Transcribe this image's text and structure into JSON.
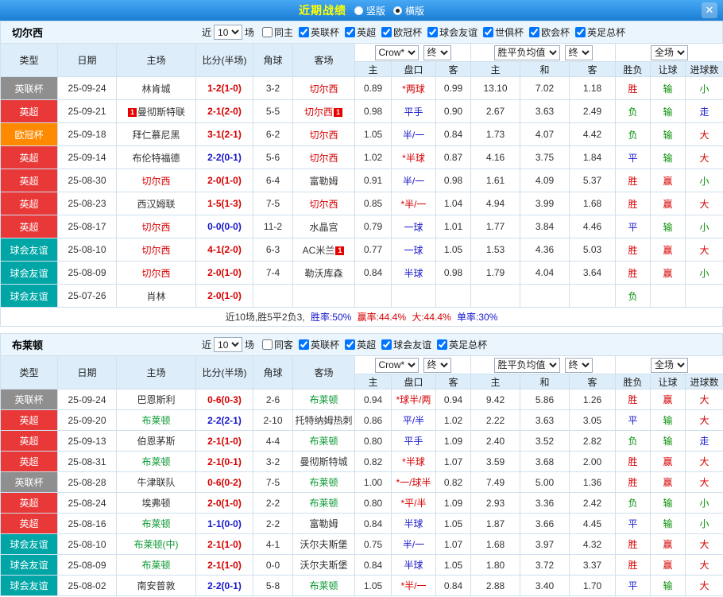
{
  "topbar": {
    "title": "近期战绩",
    "radio_vertical": "竖版",
    "radio_horizontal": "横版",
    "selected": "横版",
    "close": "✕"
  },
  "columns": {
    "type": "类型",
    "date": "日期",
    "home": "主场",
    "score": "比分(半场)",
    "corner": "角球",
    "away": "客场",
    "odds_home": "主",
    "odds_handicap": "盘口",
    "odds_away": "客",
    "avg_home": "主",
    "avg_draw": "和",
    "avg_away": "客",
    "result": "胜负",
    "handicap_result": "让球",
    "goals": "进球数"
  },
  "palette": {
    "type_colors": {
      "英联杯": "#8f8f8f",
      "英超": "#e83838",
      "欧冠杯": "#ff8a00",
      "球会友谊": "#00a6a6"
    },
    "result_colors": {
      "胜": "#d60000",
      "平": "#1515cc",
      "负": "#0b8f0b",
      "赢": "#d60000",
      "输": "#0b8f0b",
      "走": "#1515cc",
      "大": "#d60000",
      "小": "#0b8f0b"
    },
    "handicap_star_color": "#d60000",
    "handicap_color": "#1515cc",
    "score_win_color": "#d60000",
    "score_draw_color": "#1515cc"
  },
  "sections": [
    {
      "team": "切尔西",
      "team_color": "#d60000",
      "filter": {
        "near_label": "近",
        "count": "10",
        "matches_label": "场",
        "checkboxes": [
          {
            "label": "同主",
            "checked": false
          },
          {
            "label": "英联杯",
            "checked": true
          },
          {
            "label": "英超",
            "checked": true
          },
          {
            "label": "欧冠杯",
            "checked": true
          },
          {
            "label": "球会友谊",
            "checked": true
          },
          {
            "label": "世俱杯",
            "checked": true
          },
          {
            "label": "欧会杯",
            "checked": true
          },
          {
            "label": "英足总杯",
            "checked": true
          }
        ]
      },
      "selects": {
        "odds_source": "Crow*",
        "odds_time": "终",
        "avg_source": "胜平负均值",
        "avg_time": "终",
        "scope": "全场"
      },
      "rows": [
        {
          "type": "英联杯",
          "date": "25-09-24",
          "home": "林肯城",
          "home_card": "",
          "home_focus": false,
          "score": "1-2(1-0)",
          "corner": "3-2",
          "away": "切尔西",
          "away_card": "",
          "away_focus": true,
          "odds_home": "0.89",
          "handicap": "*两球",
          "odds_away": "0.99",
          "avg_home": "13.10",
          "avg_draw": "7.02",
          "avg_away": "1.18",
          "result": "胜",
          "handicap_result": "输",
          "goals": "小"
        },
        {
          "type": "英超",
          "date": "25-09-21",
          "home": "曼彻斯特联",
          "home_card": "1",
          "home_focus": false,
          "score": "2-1(2-0)",
          "corner": "5-5",
          "away": "切尔西",
          "away_card": "1",
          "away_focus": true,
          "odds_home": "0.98",
          "handicap": "平手",
          "odds_away": "0.90",
          "avg_home": "2.67",
          "avg_draw": "3.63",
          "avg_away": "2.49",
          "result": "负",
          "handicap_result": "输",
          "goals": "走"
        },
        {
          "type": "欧冠杯",
          "date": "25-09-18",
          "home": "拜仁慕尼黑",
          "home_card": "",
          "home_focus": false,
          "score": "3-1(2-1)",
          "corner": "6-2",
          "away": "切尔西",
          "away_card": "",
          "away_focus": true,
          "odds_home": "1.05",
          "handicap": "半/一",
          "odds_away": "0.84",
          "avg_home": "1.73",
          "avg_draw": "4.07",
          "avg_away": "4.42",
          "result": "负",
          "handicap_result": "输",
          "goals": "大"
        },
        {
          "type": "英超",
          "date": "25-09-14",
          "home": "布伦特福德",
          "home_card": "",
          "home_focus": false,
          "score": "2-2(0-1)",
          "corner": "5-6",
          "away": "切尔西",
          "away_card": "",
          "away_focus": true,
          "odds_home": "1.02",
          "handicap": "*半球",
          "odds_away": "0.87",
          "avg_home": "4.16",
          "avg_draw": "3.75",
          "avg_away": "1.84",
          "result": "平",
          "handicap_result": "输",
          "goals": "大"
        },
        {
          "type": "英超",
          "date": "25-08-30",
          "home": "切尔西",
          "home_card": "",
          "home_focus": true,
          "score": "2-0(1-0)",
          "corner": "6-4",
          "away": "富勒姆",
          "away_card": "",
          "away_focus": false,
          "odds_home": "0.91",
          "handicap": "半/一",
          "odds_away": "0.98",
          "avg_home": "1.61",
          "avg_draw": "4.09",
          "avg_away": "5.37",
          "result": "胜",
          "handicap_result": "赢",
          "goals": "小"
        },
        {
          "type": "英超",
          "date": "25-08-23",
          "home": "西汉姆联",
          "home_card": "",
          "home_focus": false,
          "score": "1-5(1-3)",
          "corner": "7-5",
          "away": "切尔西",
          "away_card": "",
          "away_focus": true,
          "odds_home": "0.85",
          "handicap": "*半/一",
          "odds_away": "1.04",
          "avg_home": "4.94",
          "avg_draw": "3.99",
          "avg_away": "1.68",
          "result": "胜",
          "handicap_result": "赢",
          "goals": "大"
        },
        {
          "type": "英超",
          "date": "25-08-17",
          "home": "切尔西",
          "home_card": "",
          "home_focus": true,
          "score": "0-0(0-0)",
          "corner": "11-2",
          "away": "水晶宫",
          "away_card": "",
          "away_focus": false,
          "odds_home": "0.79",
          "handicap": "一球",
          "odds_away": "1.01",
          "avg_home": "1.77",
          "avg_draw": "3.84",
          "avg_away": "4.46",
          "result": "平",
          "handicap_result": "输",
          "goals": "小"
        },
        {
          "type": "球会友谊",
          "date": "25-08-10",
          "home": "切尔西",
          "home_card": "",
          "home_focus": true,
          "score": "4-1(2-0)",
          "corner": "6-3",
          "away": "AC米兰",
          "away_card": "1",
          "away_focus": false,
          "odds_home": "0.77",
          "handicap": "一球",
          "odds_away": "1.05",
          "avg_home": "1.53",
          "avg_draw": "4.36",
          "avg_away": "5.03",
          "result": "胜",
          "handicap_result": "赢",
          "goals": "大"
        },
        {
          "type": "球会友谊",
          "date": "25-08-09",
          "home": "切尔西",
          "home_card": "",
          "home_focus": true,
          "score": "2-0(1-0)",
          "corner": "7-4",
          "away": "勒沃库森",
          "away_card": "",
          "away_focus": false,
          "odds_home": "0.84",
          "handicap": "半球",
          "odds_away": "0.98",
          "avg_home": "1.79",
          "avg_draw": "4.04",
          "avg_away": "3.64",
          "result": "胜",
          "handicap_result": "赢",
          "goals": "小"
        },
        {
          "type": "球会友谊",
          "date": "25-07-26",
          "home": "肖林",
          "home_card": "",
          "home_focus": false,
          "score": "2-0(1-0)",
          "corner": "",
          "away": "",
          "away_card": "",
          "away_focus": false,
          "odds_home": "",
          "handicap": "",
          "odds_away": "",
          "avg_home": "",
          "avg_draw": "",
          "avg_away": "",
          "result": "负",
          "handicap_result": "",
          "goals": ""
        }
      ],
      "summary": [
        {
          "text": "近10场,胜5平2负3, ",
          "color": "#333333"
        },
        {
          "text": "胜率:50% ",
          "color": "#1515cc"
        },
        {
          "text": "赢率:44.4% ",
          "color": "#d60000"
        },
        {
          "text": "大:44.4% ",
          "color": "#d60000"
        },
        {
          "text": "单率:30%",
          "color": "#1515cc"
        }
      ]
    },
    {
      "team": "布莱顿",
      "team_color": "#0b9933",
      "filter": {
        "near_label": "近",
        "count": "10",
        "matches_label": "场",
        "checkboxes": [
          {
            "label": "同客",
            "checked": false
          },
          {
            "label": "英联杯",
            "checked": true
          },
          {
            "label": "英超",
            "checked": true
          },
          {
            "label": "球会友谊",
            "checked": true
          },
          {
            "label": "英足总杯",
            "checked": true
          }
        ]
      },
      "selects": {
        "odds_source": "Crow*",
        "odds_time": "终",
        "avg_source": "胜平负均值",
        "avg_time": "终",
        "scope": "全场"
      },
      "rows": [
        {
          "type": "英联杯",
          "date": "25-09-24",
          "home": "巴恩斯利",
          "home_card": "",
          "home_focus": false,
          "score": "0-6(0-3)",
          "corner": "2-6",
          "away": "布莱顿",
          "away_card": "",
          "away_focus": true,
          "odds_home": "0.94",
          "handicap": "*球半/两",
          "odds_away": "0.94",
          "avg_home": "9.42",
          "avg_draw": "5.86",
          "avg_away": "1.26",
          "result": "胜",
          "handicap_result": "赢",
          "goals": "大"
        },
        {
          "type": "英超",
          "date": "25-09-20",
          "home": "布莱顿",
          "home_card": "",
          "home_focus": true,
          "score": "2-2(2-1)",
          "corner": "2-10",
          "away": "托特纳姆热刺",
          "away_card": "",
          "away_focus": false,
          "odds_home": "0.86",
          "handicap": "平/半",
          "odds_away": "1.02",
          "avg_home": "2.22",
          "avg_draw": "3.63",
          "avg_away": "3.05",
          "result": "平",
          "handicap_result": "输",
          "goals": "大"
        },
        {
          "type": "英超",
          "date": "25-09-13",
          "home": "伯恩茅斯",
          "home_card": "",
          "home_focus": false,
          "score": "2-1(1-0)",
          "corner": "4-4",
          "away": "布莱顿",
          "away_card": "",
          "away_focus": true,
          "odds_home": "0.80",
          "handicap": "平手",
          "odds_away": "1.09",
          "avg_home": "2.40",
          "avg_draw": "3.52",
          "avg_away": "2.82",
          "result": "负",
          "handicap_result": "输",
          "goals": "走"
        },
        {
          "type": "英超",
          "date": "25-08-31",
          "home": "布莱顿",
          "home_card": "",
          "home_focus": true,
          "score": "2-1(0-1)",
          "corner": "3-2",
          "away": "曼彻斯特城",
          "away_card": "",
          "away_focus": false,
          "odds_home": "0.82",
          "handicap": "*半球",
          "odds_away": "1.07",
          "avg_home": "3.59",
          "avg_draw": "3.68",
          "avg_away": "2.00",
          "result": "胜",
          "handicap_result": "赢",
          "goals": "大"
        },
        {
          "type": "英联杯",
          "date": "25-08-28",
          "home": "牛津联队",
          "home_card": "",
          "home_focus": false,
          "score": "0-6(0-2)",
          "corner": "7-5",
          "away": "布莱顿",
          "away_card": "",
          "away_focus": true,
          "odds_home": "1.00",
          "handicap": "*一/球半",
          "odds_away": "0.82",
          "avg_home": "7.49",
          "avg_draw": "5.00",
          "avg_away": "1.36",
          "result": "胜",
          "handicap_result": "赢",
          "goals": "大"
        },
        {
          "type": "英超",
          "date": "25-08-24",
          "home": "埃弗顿",
          "home_card": "",
          "home_focus": false,
          "score": "2-0(1-0)",
          "corner": "2-2",
          "away": "布莱顿",
          "away_card": "",
          "away_focus": true,
          "odds_home": "0.80",
          "handicap": "*平/半",
          "odds_away": "1.09",
          "avg_home": "2.93",
          "avg_draw": "3.36",
          "avg_away": "2.42",
          "result": "负",
          "handicap_result": "输",
          "goals": "小"
        },
        {
          "type": "英超",
          "date": "25-08-16",
          "home": "布莱顿",
          "home_card": "",
          "home_focus": true,
          "score": "1-1(0-0)",
          "corner": "2-2",
          "away": "富勒姆",
          "away_card": "",
          "away_focus": false,
          "odds_home": "0.84",
          "handicap": "半球",
          "odds_away": "1.05",
          "avg_home": "1.87",
          "avg_draw": "3.66",
          "avg_away": "4.45",
          "result": "平",
          "handicap_result": "输",
          "goals": "小"
        },
        {
          "type": "球会友谊",
          "date": "25-08-10",
          "home": "布莱顿(中)",
          "home_card": "",
          "home_focus": true,
          "score": "2-1(1-0)",
          "corner": "4-1",
          "away": "沃尔夫斯堡",
          "away_card": "",
          "away_focus": false,
          "odds_home": "0.75",
          "handicap": "半/一",
          "odds_away": "1.07",
          "avg_home": "1.68",
          "avg_draw": "3.97",
          "avg_away": "4.32",
          "result": "胜",
          "handicap_result": "赢",
          "goals": "大"
        },
        {
          "type": "球会友谊",
          "date": "25-08-09",
          "home": "布莱顿",
          "home_card": "",
          "home_focus": true,
          "score": "2-1(1-0)",
          "corner": "0-0",
          "away": "沃尔夫斯堡",
          "away_card": "",
          "away_focus": false,
          "odds_home": "0.84",
          "handicap": "半球",
          "odds_away": "1.05",
          "avg_home": "1.80",
          "avg_draw": "3.72",
          "avg_away": "3.37",
          "result": "胜",
          "handicap_result": "赢",
          "goals": "大"
        },
        {
          "type": "球会友谊",
          "date": "25-08-02",
          "home": "南安普敦",
          "home_card": "",
          "home_focus": false,
          "score": "2-2(0-1)",
          "corner": "5-8",
          "away": "布莱顿",
          "away_card": "",
          "away_focus": true,
          "odds_home": "1.05",
          "handicap": "*半/一",
          "odds_away": "0.84",
          "avg_home": "2.88",
          "avg_draw": "3.40",
          "avg_away": "1.70",
          "result": "平",
          "handicap_result": "输",
          "goals": "大"
        }
      ]
    }
  ]
}
